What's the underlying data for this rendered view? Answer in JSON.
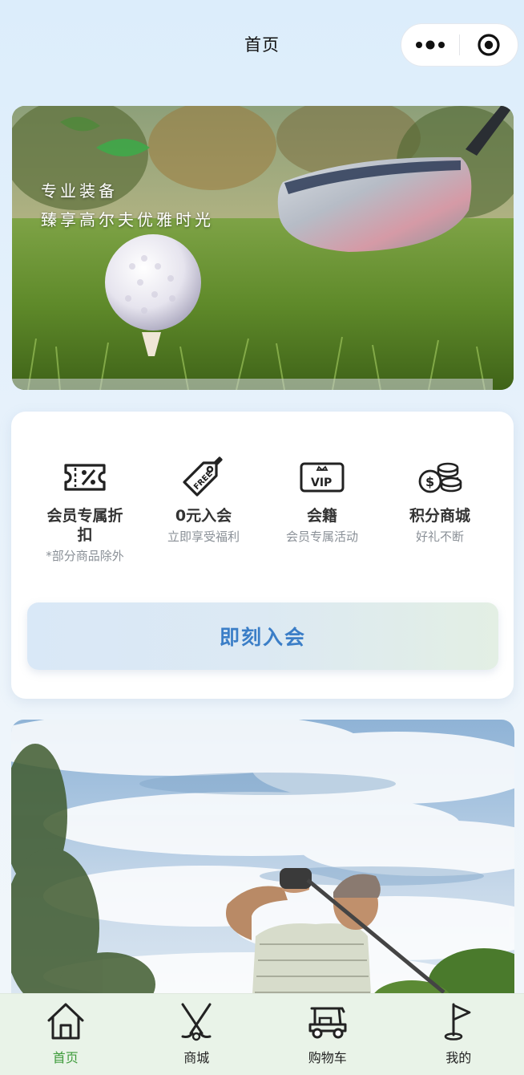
{
  "header": {
    "title": "首页",
    "capsule": {
      "more_icon": "more-dots-icon",
      "close_icon": "target-circle-icon"
    }
  },
  "banner1": {
    "slogan_line1": "专业装备",
    "slogan_line2": "臻享高尔夫优雅时光"
  },
  "benefits": [
    {
      "icon": "discount-ticket-icon",
      "title": "会员专属折扣",
      "subtitle": "*部分商品除外"
    },
    {
      "icon": "free-tag-icon",
      "title": "0元入会",
      "subtitle": "立即享受福利"
    },
    {
      "icon": "vip-card-icon",
      "title": "会籍",
      "subtitle": "会员专属活动"
    },
    {
      "icon": "coins-icon",
      "title": "积分商城",
      "subtitle": "好礼不断"
    }
  ],
  "join_button": {
    "label": "即刻入会"
  },
  "tabbar": {
    "active_color": "#3e9b3b",
    "items": [
      {
        "icon": "home-icon",
        "label": "首页",
        "active": true
      },
      {
        "icon": "golf-clubs-icon",
        "label": "商城",
        "active": false
      },
      {
        "icon": "golf-cart-icon",
        "label": "购物车",
        "active": false
      },
      {
        "icon": "golf-flag-icon",
        "label": "我的",
        "active": false
      }
    ]
  }
}
